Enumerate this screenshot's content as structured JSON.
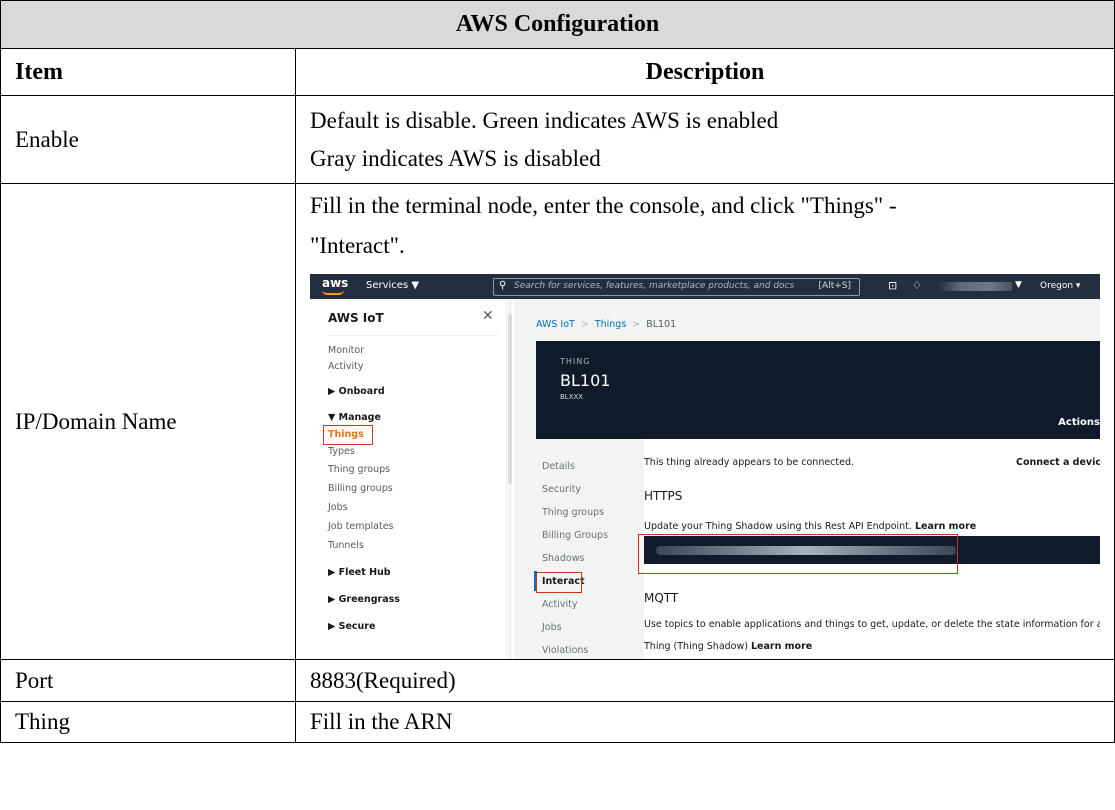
{
  "table": {
    "title": "AWS Configuration",
    "header_item": "Item",
    "header_description": "Description",
    "rows": {
      "enable": {
        "item": "Enable",
        "line1": "Default is disable. Green indicates AWS is enabled",
        "line2": "Gray indicates AWS is disabled"
      },
      "ip": {
        "item": "IP/Domain Name",
        "line1": "Fill in the terminal node, enter the console, and click \"Things\" -",
        "line2": "\"Interact\"."
      },
      "port": {
        "item": "Port",
        "desc": "8883(Required)"
      },
      "thing": {
        "item": "Thing",
        "desc": "Fill in the ARN"
      }
    }
  },
  "screenshot": {
    "topbar": {
      "logo": "aws",
      "services": "Services ▼",
      "search_placeholder": "Search for services, features, marketplace products, and docs",
      "search_shortcut": "[Alt+S]",
      "region": "Oregon ▾",
      "icons": [
        "search-icon",
        "cloudshell-icon",
        "bell-icon",
        "caret-down-icon"
      ]
    },
    "sidebar": {
      "title": "AWS IoT",
      "monitor": "Monitor",
      "activity": "Activity",
      "onboard": "▶  Onboard",
      "manage": "▼  Manage",
      "things": "Things",
      "types": "Types",
      "thing_groups": "Thing groups",
      "billing_groups": "Billing groups",
      "jobs": "Jobs",
      "job_templates": "Job templates",
      "tunnels": "Tunnels",
      "fleet_hub": "▶  Fleet Hub",
      "greengrass": "▶  Greengrass",
      "secure": "▶  Secure"
    },
    "breadcrumb": {
      "root": "AWS IoT",
      "things": "Things",
      "current": "BL101"
    },
    "hero": {
      "kicker": "THING",
      "title": "BL101",
      "subtitle": "BLXXX",
      "actions": "Actions"
    },
    "tabs": {
      "details": "Details",
      "security": "Security",
      "thing_groups": "Thing groups",
      "billing_groups": "Billing Groups",
      "shadows": "Shadows",
      "interact": "Interact",
      "activity": "Activity",
      "jobs": "Jobs",
      "violations": "Violations"
    },
    "content": {
      "connected": "This thing already appears to be connected.",
      "connect_device": "Connect a devic",
      "https_heading": "HTTPS",
      "https_text": "Update your Thing Shadow using this Rest API Endpoint.",
      "learn_more": "Learn more",
      "mqtt_heading": "MQTT",
      "mqtt_text1": "Use topics to enable applications and things to get, update, or delete the state information for a",
      "mqtt_text2": "Thing (Thing Shadow)"
    },
    "colors": {
      "topbar": "#232f3e",
      "accent": "#ec7211",
      "link": "#0073bb",
      "highlight_box": "#d13212",
      "hero": "#0f1b2a"
    }
  }
}
